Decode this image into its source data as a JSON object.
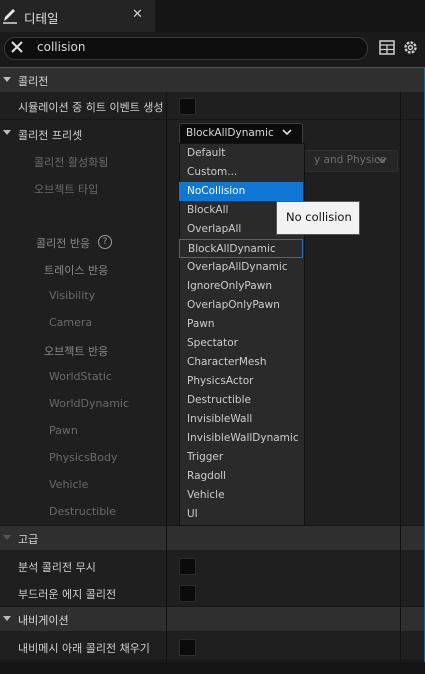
{
  "tab": {
    "title": "디테일",
    "close": "✕"
  },
  "search": {
    "value": "collision"
  },
  "categories": {
    "collision": "콜리전",
    "advanced": "고급",
    "navigation": "내비게이션"
  },
  "rows": {
    "simulation_hit": "시뮬레이션 중 히트 이벤트 생성",
    "collision_presets": "콜리전 프리셋",
    "collision_enabled": "콜리전 활성화됨",
    "object_type": "오브젝트 타입",
    "collision_response": "콜리전 반응",
    "trace_response": "트레이스 반응",
    "visibility": "Visibility",
    "camera": "Camera",
    "object_response": "오브젝트 반응",
    "world_static": "WorldStatic",
    "world_dynamic": "WorldDynamic",
    "pawn": "Pawn",
    "physics_body": "PhysicsBody",
    "vehicle": "Vehicle",
    "destructible": "Destructible",
    "ignore_analytic": "분석 콜리전 무시",
    "smooth_edge": "부드러운 에지 콜리전",
    "navmesh_fill": "내비메시 아래 콜리전 채우기"
  },
  "preset": {
    "selected": "BlockAllDynamic"
  },
  "collision_enabled_value": "y and Physics",
  "dropdown": {
    "options": [
      "Default",
      "Custom...",
      "NoCollision",
      "BlockAll",
      "OverlapAll",
      "BlockAllDynamic",
      "OverlapAllDynamic",
      "IgnoreOnlyPawn",
      "OverlapOnlyPawn",
      "Pawn",
      "Spectator",
      "CharacterMesh",
      "PhysicsActor",
      "Destructible",
      "InvisibleWall",
      "InvisibleWallDynamic",
      "Trigger",
      "Ragdoll",
      "Vehicle",
      "UI"
    ],
    "highlighted": "NoCollision",
    "current": "BlockAllDynamic"
  },
  "tooltip": "No collision",
  "help_glyph": "?",
  "colors": {
    "accent": "#0f78d4",
    "border_accent": "#1f5fa0"
  }
}
